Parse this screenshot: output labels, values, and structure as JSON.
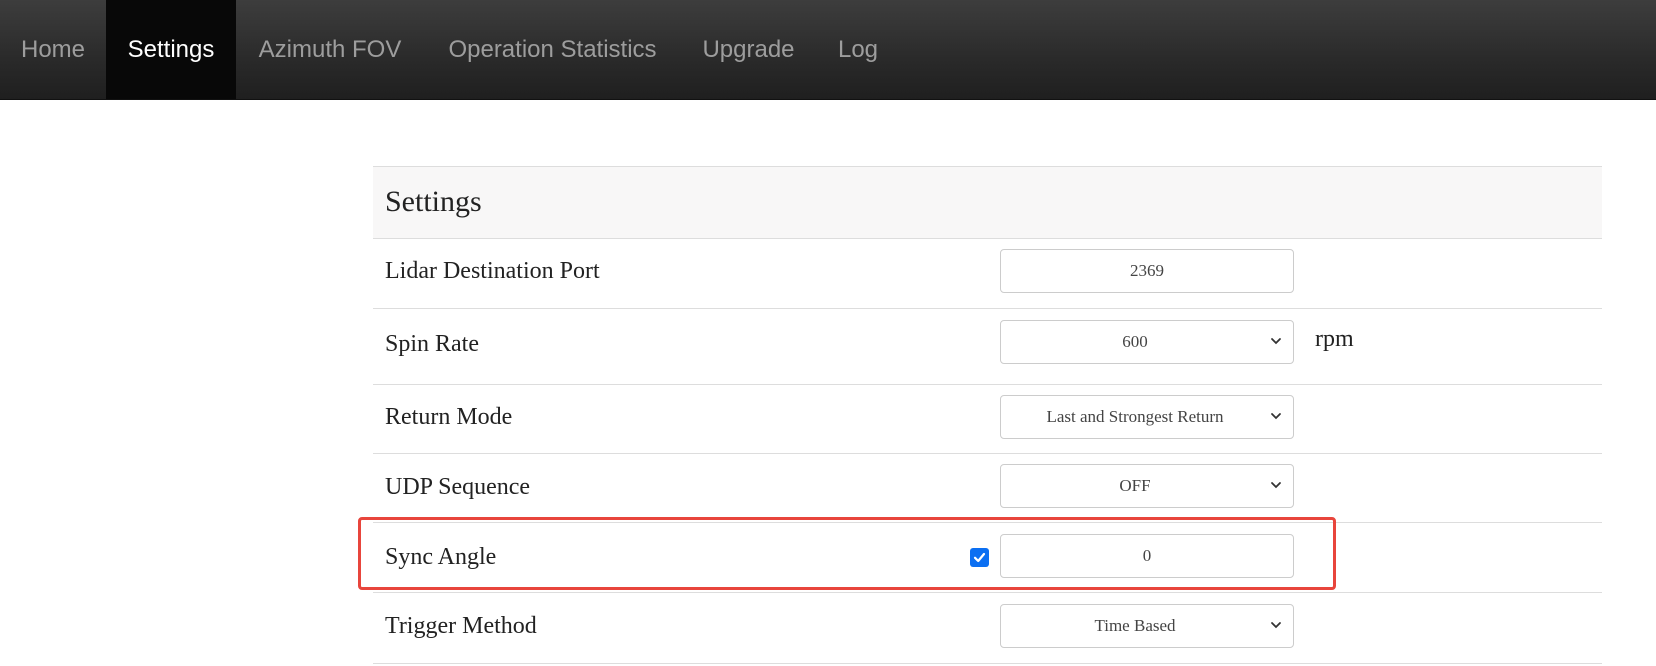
{
  "nav": {
    "items": [
      {
        "label": "Home",
        "active": false
      },
      {
        "label": "Settings",
        "active": true
      },
      {
        "label": "Azimuth FOV",
        "active": false
      },
      {
        "label": "Operation Statistics",
        "active": false
      },
      {
        "label": "Upgrade",
        "active": false
      },
      {
        "label": "Log",
        "active": false
      }
    ]
  },
  "panel": {
    "title": "Settings",
    "rows": [
      {
        "label": "Lidar Destination Port",
        "value": "2369",
        "control": "text"
      },
      {
        "label": "Spin Rate",
        "value": "600",
        "control": "select",
        "unit": "rpm"
      },
      {
        "label": "Return Mode",
        "value": "Last and Strongest Return",
        "control": "select"
      },
      {
        "label": "UDP Sequence",
        "value": "OFF",
        "control": "select"
      },
      {
        "label": "Sync Angle",
        "value": "0",
        "control": "text",
        "checkbox_checked": true,
        "highlighted": true
      },
      {
        "label": "Trigger Method",
        "value": "Time Based",
        "control": "select"
      }
    ]
  },
  "colors": {
    "highlight": "#e8453c",
    "checkbox": "#0b6ff2",
    "nav_active_bg": "#080808"
  }
}
